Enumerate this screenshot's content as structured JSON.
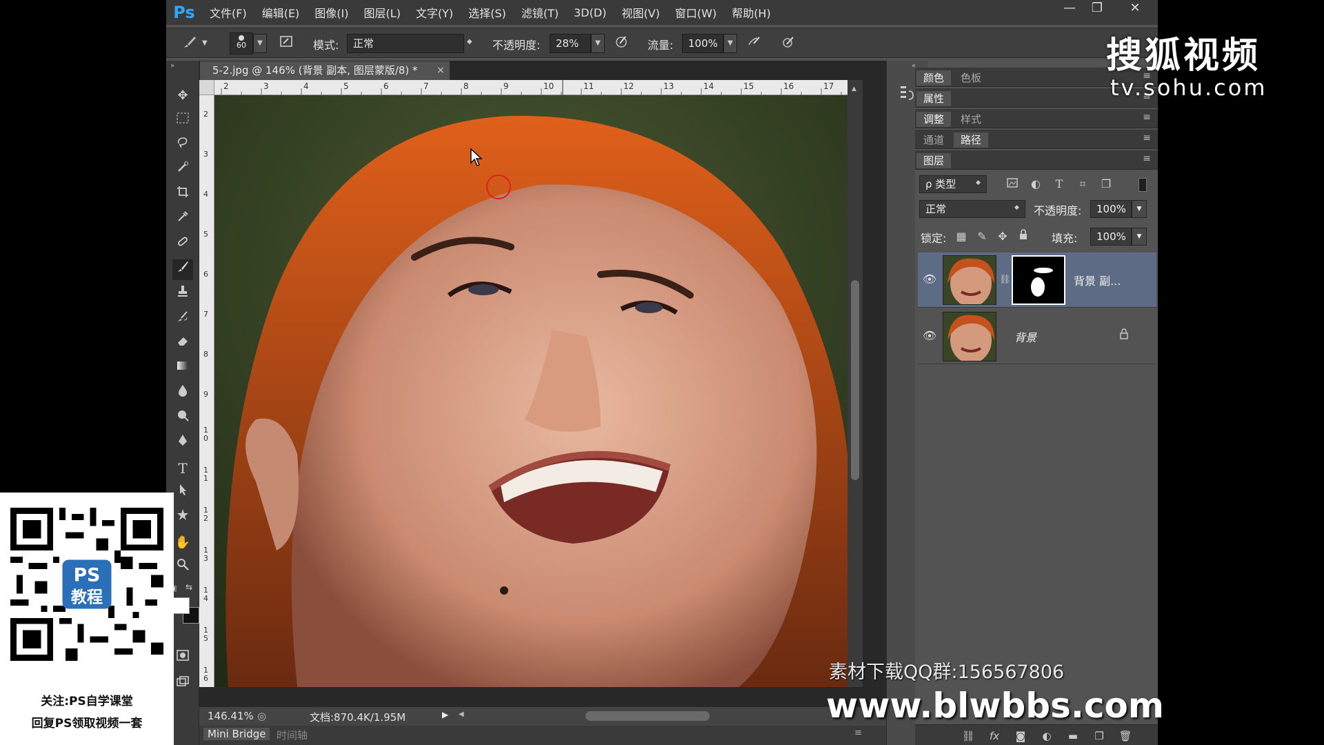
{
  "menubar": {
    "logo": "Ps",
    "items": [
      "文件(F)",
      "编辑(E)",
      "图像(I)",
      "图层(L)",
      "文字(Y)",
      "选择(S)",
      "滤镜(T)",
      "3D(D)",
      "视图(V)",
      "窗口(W)",
      "帮助(H)"
    ]
  },
  "window_controls": {
    "minimize": "—",
    "restore": "❐",
    "close": "✕"
  },
  "options": {
    "brush_size": "60",
    "mode_label": "模式:",
    "mode_value": "正常",
    "opacity_label": "不透明度:",
    "opacity_value": "28%",
    "flow_label": "流量:",
    "flow_value": "100%"
  },
  "document": {
    "tab_title": "5-2.jpg @ 146% (背景 副本, 图层蒙版/8) *",
    "close": "×",
    "ruler_top": [
      "2",
      "3",
      "4",
      "5",
      "6",
      "7",
      "8",
      "9",
      "10",
      "11",
      "12",
      "13",
      "14",
      "15",
      "16",
      "17"
    ],
    "ruler_left": [
      "2",
      "3",
      "4",
      "5",
      "6",
      "7",
      "8",
      "9",
      "1\n0",
      "1\n1",
      "1\n2",
      "1\n3",
      "1\n4",
      "1\n5",
      "1\n6"
    ],
    "zoom": "146.41%",
    "doc_size": "文档:870.4K/1.95M"
  },
  "bottom_tabs": [
    "Mini Bridge",
    "时间轴"
  ],
  "panels": {
    "row1": [
      "颜色",
      "色板"
    ],
    "row2": [
      "属性"
    ],
    "row3": [
      "调整",
      "样式"
    ],
    "row4": [
      "通道",
      "路径"
    ],
    "layers_title": "图层",
    "filter_kind": "ρ 类型",
    "blend_mode": "正常",
    "opacity_label": "不透明度:",
    "opacity_value": "100%",
    "lock_label": "锁定:",
    "fill_label": "填充:",
    "fill_value": "100%",
    "layers": [
      {
        "name": "背景 副...",
        "selected": true,
        "has_mask": true
      },
      {
        "name": "背景",
        "selected": false,
        "locked": true
      }
    ],
    "footer_icons": [
      "link-icon",
      "fx-icon",
      "mask-icon",
      "adjustment-icon",
      "folder-icon",
      "new-layer-icon",
      "trash-icon"
    ]
  },
  "qr_card": {
    "badge_top": "PS",
    "badge_bottom": "教程",
    "line1": "关注:PS自学课堂",
    "line2": "回复PS领取视频一套"
  },
  "watermarks": {
    "sohu_logo": "搜狐视频",
    "sohu_url": "tv.sohu.com",
    "qq_group": "素材下载QQ群:156567806",
    "site_url": "www.blwbbs.com"
  },
  "colors": {
    "ps_blue": "#31a8ff",
    "panel_bg": "#535353",
    "selected_layer": "#5d6b85",
    "brush_cursor": "#e02020"
  }
}
